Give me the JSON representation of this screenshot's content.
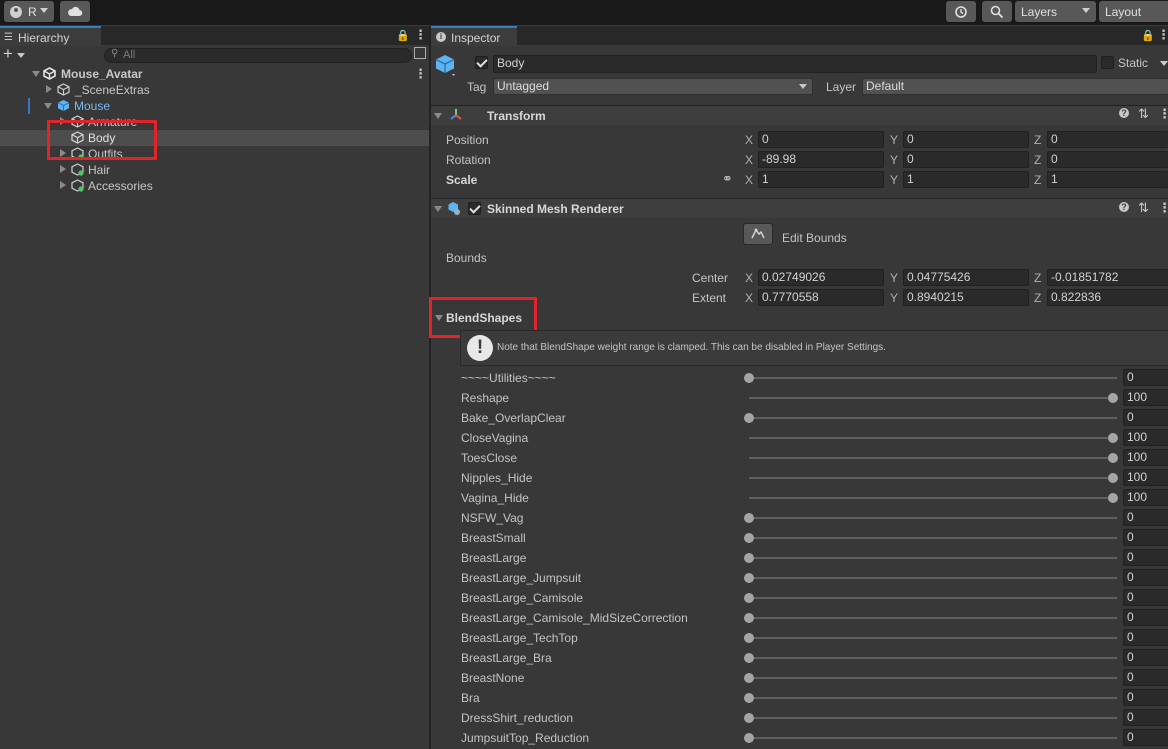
{
  "toolbar": {
    "account_label": "R",
    "layers_label": "Layers",
    "layout_label": "Layout"
  },
  "hierarchy": {
    "tab_label": "Hierarchy",
    "search_placeholder": "All",
    "scene_name": "Mouse_Avatar",
    "items": [
      {
        "label": "_SceneExtras"
      },
      {
        "label": "Mouse"
      },
      {
        "label": "Armature"
      },
      {
        "label": "Body"
      },
      {
        "label": "Outfits"
      },
      {
        "label": "Hair"
      },
      {
        "label": "Accessories"
      }
    ]
  },
  "inspector": {
    "tab_label": "Inspector",
    "object_name": "Body",
    "static_label": "Static",
    "tag_label": "Tag",
    "tag_value": "Untagged",
    "layer_label": "Layer",
    "layer_value": "Default",
    "transform": {
      "title": "Transform",
      "position_label": "Position",
      "rotation_label": "Rotation",
      "scale_label": "Scale",
      "position": {
        "x": "0",
        "y": "0",
        "z": "0"
      },
      "rotation": {
        "x": "-89.98",
        "y": "0",
        "z": "0"
      },
      "scale": {
        "x": "1",
        "y": "1",
        "z": "1"
      }
    },
    "axis": {
      "x": "X",
      "y": "Y",
      "z": "Z"
    },
    "smr": {
      "title": "Skinned Mesh Renderer",
      "edit_bounds_label": "Edit Bounds",
      "bounds_label": "Bounds",
      "center_label": "Center",
      "extent_label": "Extent",
      "center": {
        "x": "0.02749026",
        "y": "0.04775426",
        "z": "-0.01851782"
      },
      "extent": {
        "x": "0.7770558",
        "y": "0.8940215",
        "z": "0.822836"
      }
    },
    "blendshapes": {
      "title": "BlendShapes",
      "note": "Note that BlendShape weight range is clamped. This can be disabled in Player Settings.",
      "items": [
        {
          "name": "~~~~Utilities~~~~",
          "value": 0
        },
        {
          "name": "Reshape",
          "value": 100
        },
        {
          "name": "Bake_OverlapClear",
          "value": 0
        },
        {
          "name": "CloseVagina",
          "value": 100
        },
        {
          "name": "ToesClose",
          "value": 100
        },
        {
          "name": "Nipples_Hide",
          "value": 100
        },
        {
          "name": "Vagina_Hide",
          "value": 100
        },
        {
          "name": "NSFW_Vag",
          "value": 0
        },
        {
          "name": "BreastSmall",
          "value": 0
        },
        {
          "name": "BreastLarge",
          "value": 0
        },
        {
          "name": "BreastLarge_Jumpsuit",
          "value": 0
        },
        {
          "name": "BreastLarge_Camisole",
          "value": 0
        },
        {
          "name": "BreastLarge_Camisole_MidSizeCorrection",
          "value": 0
        },
        {
          "name": "BreastLarge_TechTop",
          "value": 0
        },
        {
          "name": "BreastLarge_Bra",
          "value": 0
        },
        {
          "name": "BreastNone",
          "value": 0
        },
        {
          "name": "Bra",
          "value": 0
        },
        {
          "name": "DressShirt_reduction",
          "value": 0
        },
        {
          "name": "JumpsuitTop_Reduction",
          "value": 0
        }
      ]
    }
  }
}
